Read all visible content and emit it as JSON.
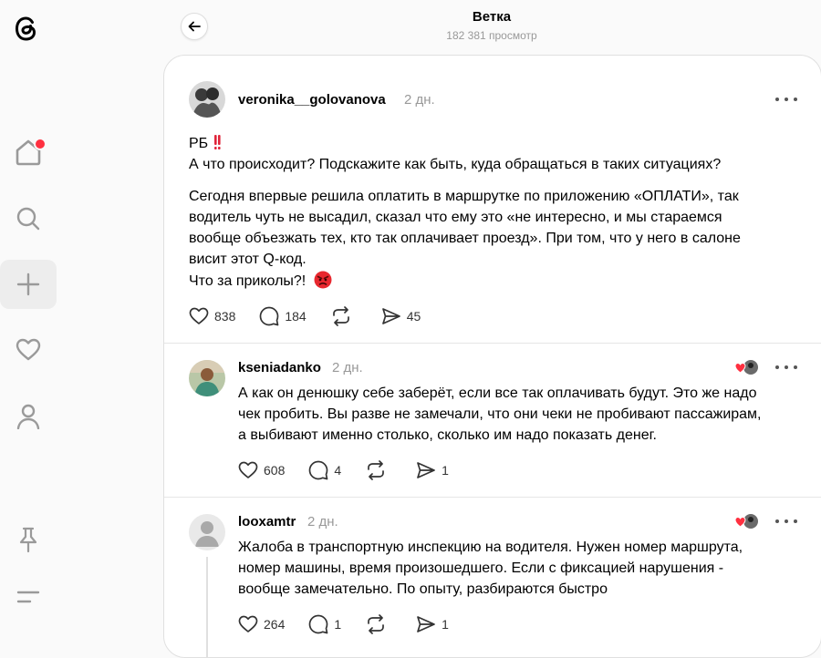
{
  "header": {
    "title": "Ветка",
    "views": "182 381 просмотр"
  },
  "sidebar": {
    "items": [
      {
        "name": "home-icon",
        "active": false,
        "notification": true
      },
      {
        "name": "search-icon",
        "active": false
      },
      {
        "name": "plus-icon",
        "active": true
      },
      {
        "name": "heart-icon",
        "active": false
      },
      {
        "name": "profile-icon",
        "active": false
      },
      {
        "name": "pin-icon",
        "active": false
      },
      {
        "name": "menu-icon",
        "active": false
      }
    ]
  },
  "post": {
    "username": "veronika__golovanova",
    "time": "2 дн.",
    "line1": "РБ",
    "line2": "А что происходит? Подскажите как быть, куда обращаться в таких ситуациях?",
    "paragraph": [
      "Сегодня впервые решила оплатить в маршрутке по приложению «ОПЛАТИ», так",
      "водитель чуть не высадил, сказал что ему это «не интересно, и мы стараемся",
      "вообще объезжать тех, кто так оплачивает проезд». При том, что у него в салоне",
      "висит этот Q-код."
    ],
    "last_line": "Что за приколы?!",
    "likes": "838",
    "comments": "184",
    "shares": "45"
  },
  "replies": [
    {
      "username": "kseniadanko",
      "time": "2 дн.",
      "lines": [
        "А как он денюшку себе заберёт, если все так оплачивать будут. Это же надо",
        "чек пробить. Вы разве не замечали, что они чеки не пробивают пассажирам,",
        "а выбивают именно столько, сколько им надо показать денег."
      ],
      "likes": "608",
      "comments": "4",
      "shares": "1"
    },
    {
      "username": "looxamtr",
      "time": "2 дн.",
      "lines": [
        "Жалоба в транспортную инспекцию на водителя. Нужен номер маршрута,",
        "номер машины, время произошедшего. Если с фиксацией нарушения -",
        "вообще замечательно. По опыту, разбираются быстро"
      ],
      "likes": "264",
      "comments": "1",
      "shares": "1"
    }
  ],
  "colors": {
    "accent_red": "#ff3040",
    "muted": "#999999",
    "border": "#e0e0e0"
  }
}
